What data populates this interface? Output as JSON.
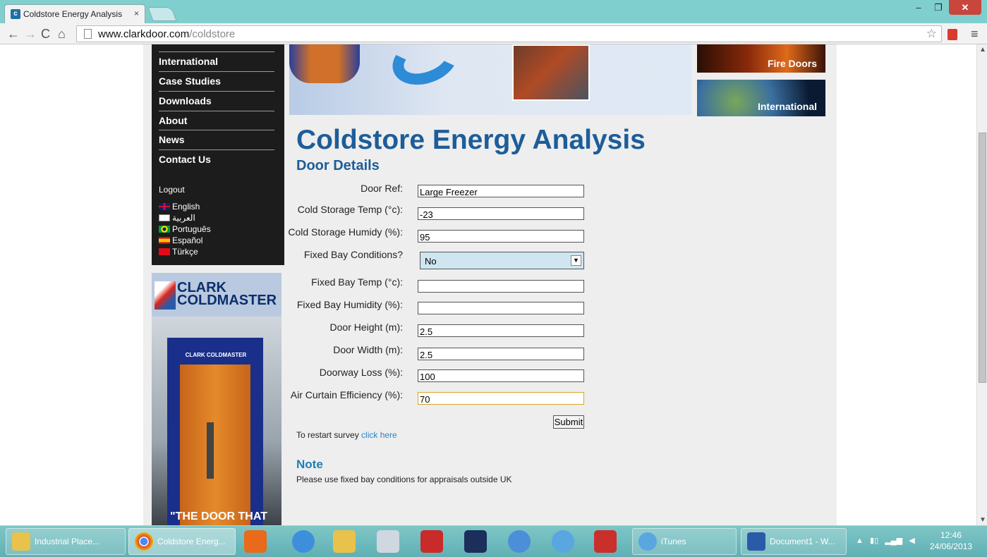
{
  "browser": {
    "tab_title": "Coldstore Energy Analysis",
    "tab_close": "×",
    "url_host": "www.clarkdoor.com",
    "url_path": "/coldstore",
    "window_controls": {
      "minimize": "–",
      "maximize": "❐",
      "close": "✕"
    },
    "nav": {
      "back": "←",
      "forward": "→",
      "reload": "C",
      "home": "⌂",
      "star": "☆",
      "menu": "≡"
    }
  },
  "sidebar": {
    "items": [
      {
        "label": "International"
      },
      {
        "label": "Case Studies"
      },
      {
        "label": "Downloads"
      },
      {
        "label": "About"
      },
      {
        "label": "News"
      },
      {
        "label": "Contact Us"
      }
    ],
    "logout": "Logout",
    "languages": [
      {
        "label": "English",
        "flag": "flag-uk"
      },
      {
        "label": "العربية",
        "flag": "flag-ar"
      },
      {
        "label": "Português",
        "flag": "flag-br"
      },
      {
        "label": "Español",
        "flag": "flag-es"
      },
      {
        "label": "Türkçe",
        "flag": "flag-tr"
      }
    ]
  },
  "ad": {
    "brand": "CLARK\nCOLDMASTER",
    "door_label": "CLARK COLDMASTER",
    "tagline": "\"THE DOOR THAT"
  },
  "promos": {
    "fire": "Fire Doors",
    "international": "International"
  },
  "page": {
    "title": "Coldstore Energy Analysis",
    "section": "Door Details"
  },
  "form": {
    "door_ref": {
      "label": "Door Ref:",
      "value": "Large Freezer"
    },
    "cold_temp": {
      "label": "Cold Storage Temp (°c):",
      "value": "-23"
    },
    "cold_humidity": {
      "label": "Cold Storage Humidy (%):",
      "value": "95"
    },
    "fixed_bay": {
      "label": "Fixed Bay Conditions?",
      "value": "No"
    },
    "bay_temp": {
      "label": "Fixed Bay Temp (°c):",
      "value": ""
    },
    "bay_humidity": {
      "label": "Fixed Bay Humidity (%):",
      "value": ""
    },
    "door_height": {
      "label": "Door Height (m):",
      "value": "2.5"
    },
    "door_width": {
      "label": "Door Width (m):",
      "value": "2.5"
    },
    "doorway_loss": {
      "label": "Doorway Loss (%):",
      "value": "100"
    },
    "air_curtain": {
      "label": "Air Curtain Efficiency (%):",
      "value": "70"
    },
    "submit_label": "Submit"
  },
  "restart": {
    "text": "To restart survey ",
    "link": "click here"
  },
  "note": {
    "title": "Note",
    "text": "Please use fixed bay conditions for appraisals outside UK"
  },
  "taskbar": {
    "tasks": [
      {
        "label": "Industrial Place...",
        "icon": "folder-icon"
      },
      {
        "label": "Coldstore Energ...",
        "icon": "chrome-icon"
      },
      {
        "label": "iTunes",
        "icon": "itunes-icon"
      },
      {
        "label": "Document1 - W...",
        "icon": "word-icon"
      }
    ],
    "time": "12:46",
    "date": "24/06/2013"
  },
  "colors": {
    "accent": "#1d5d99",
    "tabbar": "#7fcfcf",
    "sidebar": "#1c1c1c",
    "link": "#2c82c0"
  }
}
